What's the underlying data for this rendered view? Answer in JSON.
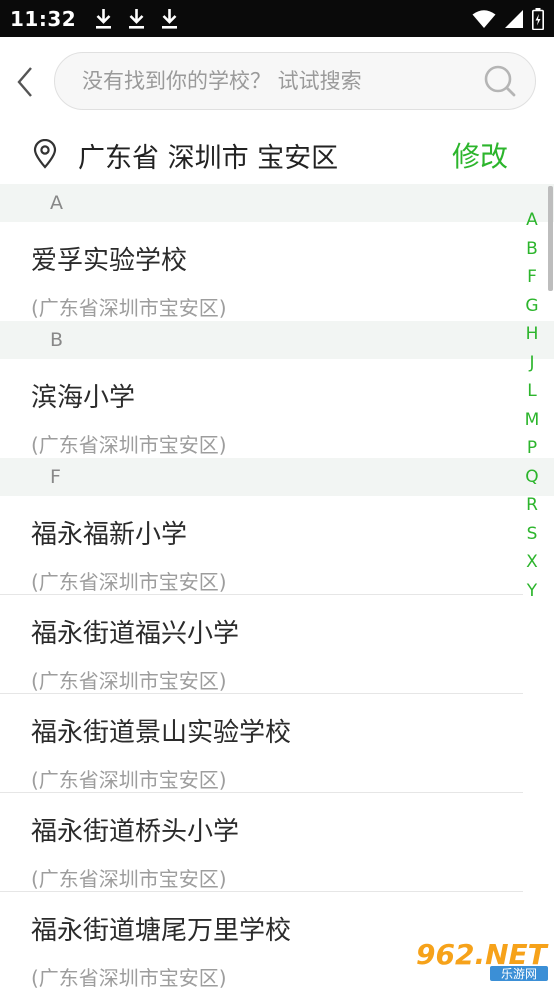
{
  "status_bar": {
    "time": "11:32",
    "icons": [
      "download-icon",
      "download-icon",
      "download-icon",
      "wifi-icon",
      "signal-icon",
      "battery-icon"
    ]
  },
  "header": {
    "back_icon": "chevron-left-icon",
    "search": {
      "placeholder": "没有找到你的学校？ 试试搜索",
      "value": "",
      "icon": "search-icon"
    }
  },
  "location": {
    "icon": "location-pin-icon",
    "text": "广东省 深圳市 宝安区",
    "edit_label": "修改"
  },
  "colors": {
    "accent": "#2cb52c",
    "section_bg": "#f2f5f3",
    "status_bar_bg": "#0a0a0a"
  },
  "sections": [
    {
      "letter": "A",
      "schools": [
        {
          "name": "爱孚实验学校",
          "region": "(广东省深圳市宝安区)"
        }
      ]
    },
    {
      "letter": "B",
      "schools": [
        {
          "name": "滨海小学",
          "region": "(广东省深圳市宝安区)"
        }
      ]
    },
    {
      "letter": "F",
      "schools": [
        {
          "name": "福永福新小学",
          "region": "(广东省深圳市宝安区)"
        },
        {
          "name": "福永街道福兴小学",
          "region": "(广东省深圳市宝安区)"
        },
        {
          "name": "福永街道景山实验学校",
          "region": "(广东省深圳市宝安区)"
        },
        {
          "name": "福永街道桥头小学",
          "region": "(广东省深圳市宝安区)"
        },
        {
          "name": "福永街道塘尾万里学校",
          "region": "(广东省深圳市宝安区)"
        }
      ]
    }
  ],
  "alpha_index": [
    "A",
    "B",
    "F",
    "G",
    "H",
    "J",
    "L",
    "M",
    "P",
    "Q",
    "R",
    "S",
    "X",
    "Y"
  ],
  "watermark": {
    "text": "962.NET",
    "subtext": "乐游网"
  }
}
